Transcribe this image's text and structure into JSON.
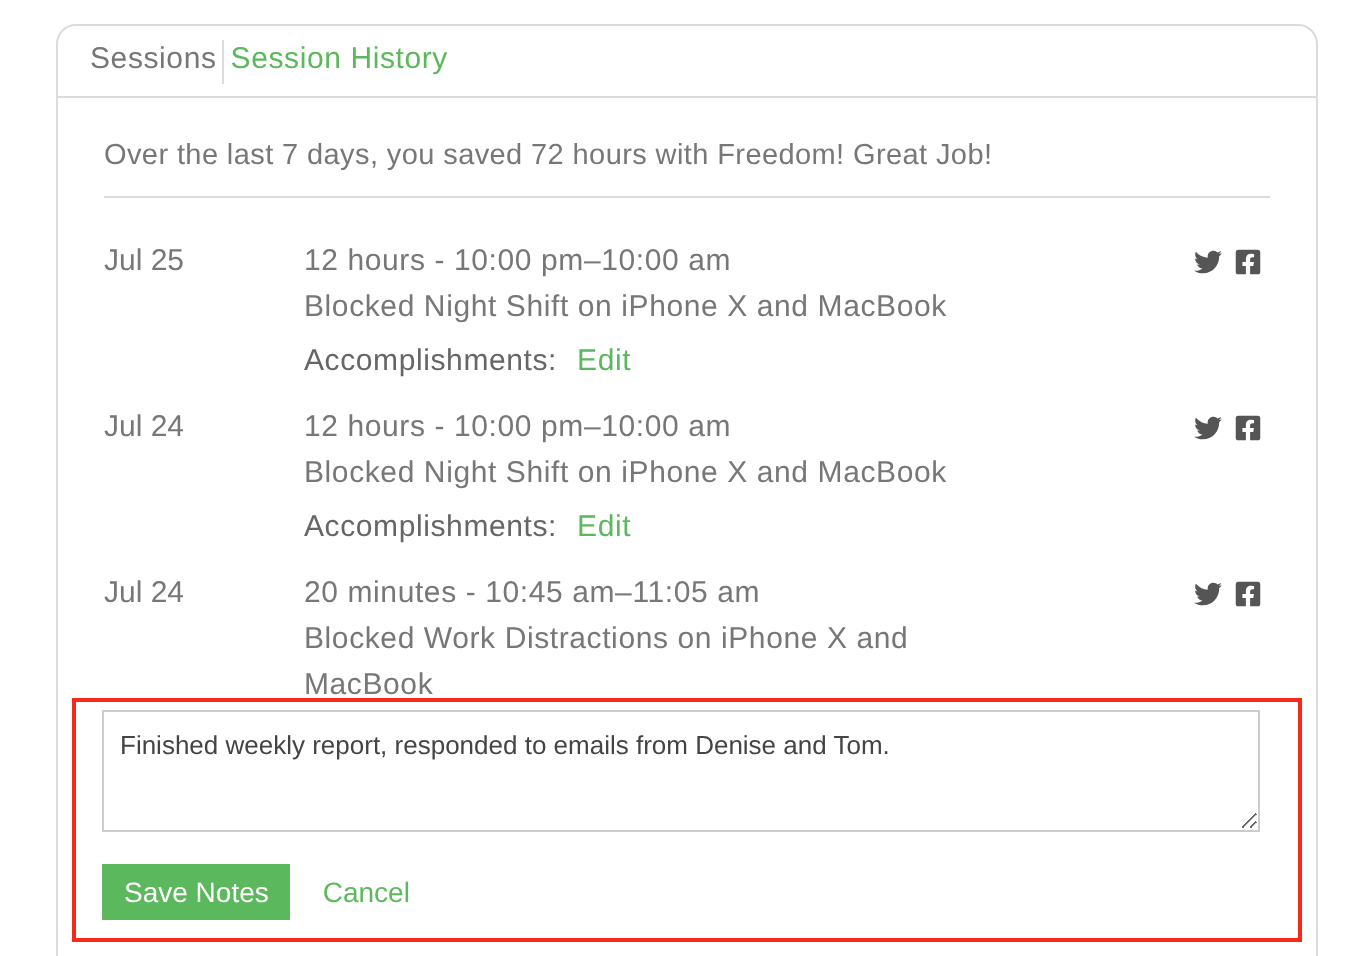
{
  "tabs": [
    {
      "label": "Sessions",
      "selected": false
    },
    {
      "label": "Session History",
      "selected": true
    }
  ],
  "summary": "Over the last 7 days, you saved 72 hours with Freedom! Great Job!",
  "sessions": [
    {
      "date": "Jul 25",
      "time": "12 hours - 10:00 pm–10:00 am",
      "description": "Blocked Night Shift on iPhone X and MacBook",
      "accomplishments_label": "Accomplishments:",
      "edit_link": "Edit"
    },
    {
      "date": "Jul 24",
      "time": "12 hours - 10:00 pm–10:00 am",
      "description": "Blocked Night Shift on iPhone X and MacBook",
      "accomplishments_label": "Accomplishments:",
      "edit_link": "Edit"
    },
    {
      "date": "Jul 24",
      "time": "20 minutes - 10:45 am–11:05 am",
      "description": "Blocked Work Distractions on iPhone X and MacBook"
    }
  ],
  "notes_editor": {
    "value": "Finished weekly report, responded to emails from Denise and Tom.",
    "save_button": "Save Notes",
    "cancel_link": "Cancel"
  }
}
